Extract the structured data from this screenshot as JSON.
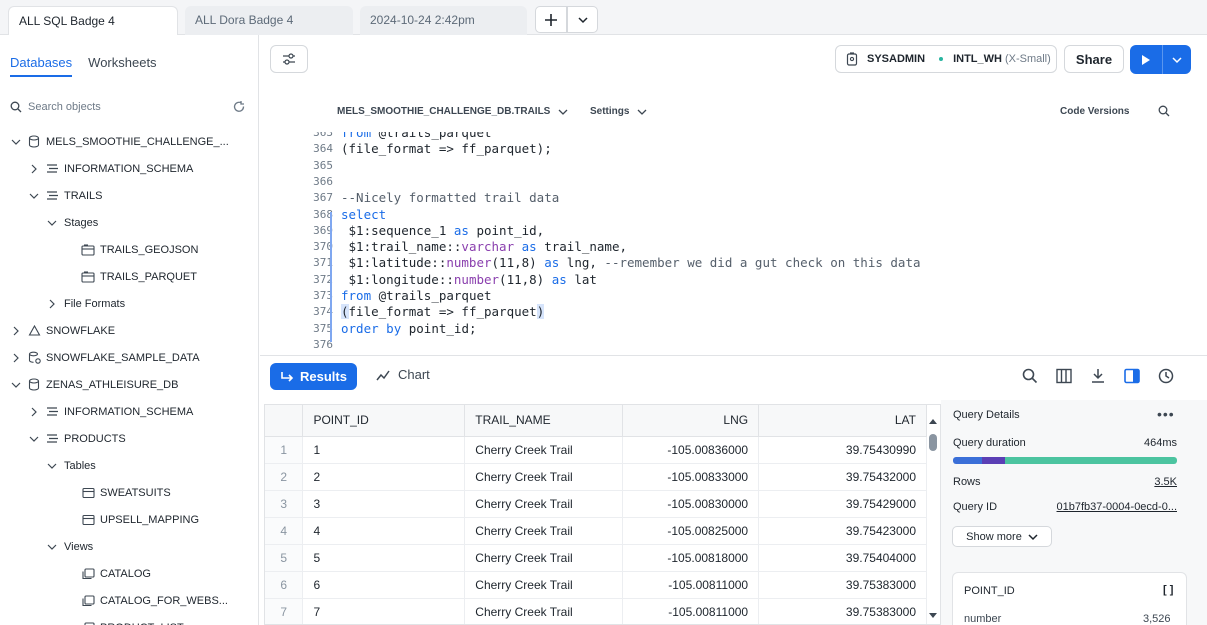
{
  "tabs": [
    {
      "label": "ALL SQL Badge 4",
      "active": true
    },
    {
      "label": "ALL Dora Badge 4",
      "active": false
    },
    {
      "label": "2024-10-24 2:42pm",
      "active": false
    }
  ],
  "sidebar": {
    "tabs": [
      "Databases",
      "Worksheets"
    ],
    "search_placeholder": "Search objects",
    "tree": [
      {
        "label": "MELS_SMOOTHIE_CHALLENGE_...",
        "level": 0,
        "expanded": true,
        "icon": "database-icon"
      },
      {
        "label": "INFORMATION_SCHEMA",
        "level": 1,
        "expanded": false,
        "icon": "schema-icon"
      },
      {
        "label": "TRAILS",
        "level": 1,
        "expanded": true,
        "icon": "schema-icon"
      },
      {
        "label": "Stages",
        "level": 2,
        "expanded": true,
        "icon": ""
      },
      {
        "label": "TRAILS_GEOJSON",
        "level": 3,
        "expanded": null,
        "icon": "stage-icon"
      },
      {
        "label": "TRAILS_PARQUET",
        "level": 3,
        "expanded": null,
        "icon": "stage-icon"
      },
      {
        "label": "File Formats",
        "level": 2,
        "expanded": false,
        "icon": ""
      },
      {
        "label": "SNOWFLAKE",
        "level": 0,
        "expanded": false,
        "icon": "shared-database-icon"
      },
      {
        "label": "SNOWFLAKE_SAMPLE_DATA",
        "level": 0,
        "expanded": false,
        "icon": "shared-database-icon"
      },
      {
        "label": "ZENAS_ATHLEISURE_DB",
        "level": 0,
        "expanded": true,
        "icon": "database-icon"
      },
      {
        "label": "INFORMATION_SCHEMA",
        "level": 1,
        "expanded": false,
        "icon": "schema-icon"
      },
      {
        "label": "PRODUCTS",
        "level": 1,
        "expanded": true,
        "icon": "schema-icon"
      },
      {
        "label": "Tables",
        "level": 2,
        "expanded": true,
        "icon": ""
      },
      {
        "label": "SWEATSUITS",
        "level": 3,
        "expanded": null,
        "icon": "table-icon"
      },
      {
        "label": "UPSELL_MAPPING",
        "level": 3,
        "expanded": null,
        "icon": "table-icon"
      },
      {
        "label": "Views",
        "level": 2,
        "expanded": true,
        "icon": ""
      },
      {
        "label": "CATALOG",
        "level": 3,
        "expanded": null,
        "icon": "view-icon"
      },
      {
        "label": "CATALOG_FOR_WEBS...",
        "level": 3,
        "expanded": null,
        "icon": "view-icon"
      },
      {
        "label": "PRODUCT_LIST",
        "level": 3,
        "expanded": null,
        "icon": "view-icon"
      }
    ]
  },
  "toolbar": {
    "role": "SYSADMIN",
    "warehouse": "INTL_WH",
    "warehouse_size": "(X-Small)",
    "share_label": "Share"
  },
  "editor": {
    "database_context": "MELS_SMOOTHIE_CHALLENGE_DB.TRAILS",
    "settings_label": "Settings",
    "code_versions_label": "Code Versions",
    "lines": [
      {
        "num": "363",
        "text": "from @trails_parquet"
      },
      {
        "num": "364",
        "text": "(file_format => ff_parquet);"
      },
      {
        "num": "365",
        "text": ""
      },
      {
        "num": "366",
        "text": ""
      },
      {
        "num": "367",
        "text": "--Nicely formatted trail data"
      },
      {
        "num": "368",
        "text": "select"
      },
      {
        "num": "369",
        "text": " $1:sequence_1 as point_id,"
      },
      {
        "num": "370",
        "text": " $1:trail_name::varchar as trail_name,"
      },
      {
        "num": "371",
        "text": " $1:latitude::number(11,8) as lng, --remember we did a gut check on this data"
      },
      {
        "num": "372",
        "text": " $1:longitude::number(11,8) as lat"
      },
      {
        "num": "373",
        "text": "from @trails_parquet"
      },
      {
        "num": "374",
        "text": "(file_format => ff_parquet)"
      },
      {
        "num": "375",
        "text": "order by point_id;"
      },
      {
        "num": "376",
        "text": ""
      }
    ]
  },
  "results": {
    "results_label": "Results",
    "chart_label": "Chart",
    "columns": [
      "POINT_ID",
      "TRAIL_NAME",
      "LNG",
      "LAT"
    ],
    "rows": [
      [
        "1",
        "1",
        "Cherry Creek Trail",
        "-105.00836000",
        "39.75430990"
      ],
      [
        "2",
        "2",
        "Cherry Creek Trail",
        "-105.00833000",
        "39.75432000"
      ],
      [
        "3",
        "3",
        "Cherry Creek Trail",
        "-105.00830000",
        "39.75429000"
      ],
      [
        "4",
        "4",
        "Cherry Creek Trail",
        "-105.00825000",
        "39.75423000"
      ],
      [
        "5",
        "5",
        "Cherry Creek Trail",
        "-105.00818000",
        "39.75404000"
      ],
      [
        "6",
        "6",
        "Cherry Creek Trail",
        "-105.00811000",
        "39.75383000"
      ],
      [
        "7",
        "7",
        "Cherry Creek Trail",
        "-105.00811000",
        "39.75383000"
      ]
    ]
  },
  "details": {
    "title": "Query Details",
    "duration_label": "Query duration",
    "duration_value": "464ms",
    "rows_label": "Rows",
    "rows_value": "3.5K",
    "query_id_label": "Query ID",
    "query_id_value": "01b7fb37-0004-0ecd-0...",
    "show_more_label": "Show more",
    "column_card": {
      "name": "POINT_ID",
      "badge": "[ ]",
      "type": "number",
      "count": "3,526"
    }
  },
  "colors": {
    "accent": "#1a6ce7",
    "bar_segments": [
      "#3a6fd8",
      "#5b3fb5",
      "#4cc4a0"
    ]
  }
}
